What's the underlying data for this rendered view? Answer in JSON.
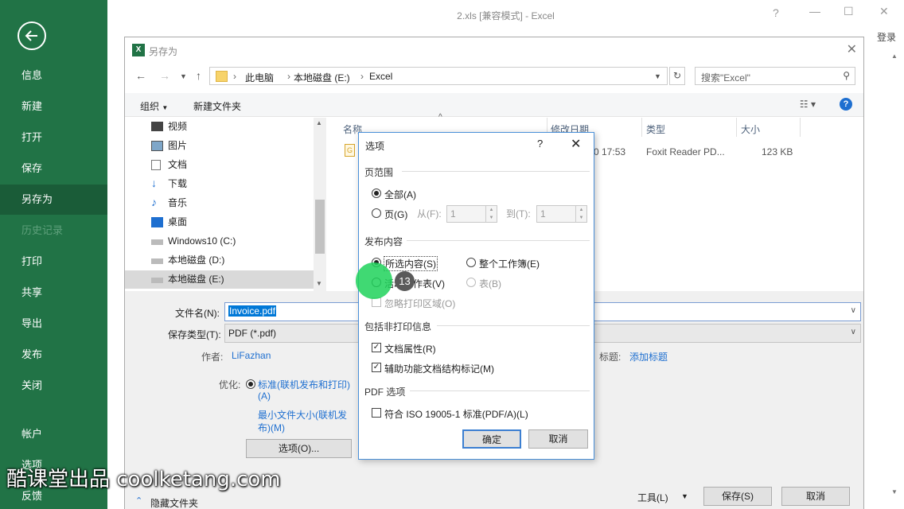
{
  "window": {
    "title": "2.xls  [兼容模式] - Excel",
    "help": "?",
    "login": "登录"
  },
  "backstage": {
    "items": [
      {
        "label": "信息"
      },
      {
        "label": "新建"
      },
      {
        "label": "打开"
      },
      {
        "label": "保存"
      },
      {
        "label": "另存为"
      },
      {
        "label": "历史记录"
      },
      {
        "label": "打印"
      },
      {
        "label": "共享"
      },
      {
        "label": "导出"
      },
      {
        "label": "发布"
      },
      {
        "label": "关闭"
      },
      {
        "label": "帐户"
      },
      {
        "label": "选项"
      },
      {
        "label": "反馈"
      }
    ]
  },
  "saveas": {
    "title": "另存为",
    "breadcrumb": [
      "此电脑",
      "本地磁盘 (E:)",
      "Excel"
    ],
    "search_placeholder": "搜索\"Excel\"",
    "toolbar": {
      "organize": "组织",
      "new_folder": "新建文件夹"
    },
    "tree": [
      {
        "label": "视频"
      },
      {
        "label": "图片"
      },
      {
        "label": "文档"
      },
      {
        "label": "下载"
      },
      {
        "label": "音乐"
      },
      {
        "label": "桌面"
      },
      {
        "label": "Windows10 (C:)"
      },
      {
        "label": "本地磁盘 (D:)"
      },
      {
        "label": "本地磁盘 (E:)"
      }
    ],
    "columns": [
      "名称",
      "修改日期",
      "类型",
      "大小"
    ],
    "file_row": {
      "date": "0 17:53",
      "type": "Foxit Reader PD...",
      "size": "123 KB"
    },
    "filename_label": "文件名(N):",
    "filename_value": "Invoice.pdf",
    "filetype_label": "保存类型(T):",
    "filetype_value": "PDF (*.pdf)",
    "author_label": "作者:",
    "author_value": "LiFazhan",
    "tags_label": "标题:",
    "tags_value": "添加标题",
    "optimize_label": "优化:",
    "opt_standard": "标准(联机发布和打印)",
    "opt_standard_2": "(A)",
    "opt_min": "最小文件大小(联机发",
    "opt_min_2": "布)(M)",
    "options_button": "选项(O)...",
    "hide_folders": "隐藏文件夹",
    "tools": "工具(L)",
    "save": "保存(S)",
    "cancel": "取消"
  },
  "options": {
    "title": "选项",
    "help": "?",
    "page_range_label": "页范围",
    "all": "全部(A)",
    "pages": "页(G)",
    "from_label": "从(F):",
    "from_value": "1",
    "to_label": "到(T):",
    "to_value": "1",
    "publish_label": "发布内容",
    "selection": "所选内容(S)",
    "entire_workbook": "整个工作簿(E)",
    "active_sheet": "活动工作表(V)",
    "table": "表(B)",
    "ignore_print_areas": "忽略打印区域(O)",
    "non_print_label": "包括非打印信息",
    "doc_properties": "文档属性(R)",
    "structure_tags": "辅助功能文档结构标记(M)",
    "pdf_options_label": "PDF 选项",
    "iso": "符合 ISO 19005-1 标准(PDF/A)(L)",
    "ok": "确定",
    "cancel": "取消"
  },
  "overlay": {
    "step": "13",
    "watermark": "酷课堂出品 coolketang.com"
  },
  "colors": {
    "excel_green": "#217346",
    "link": "#1e6fd0",
    "accent": "#4a90d9"
  }
}
